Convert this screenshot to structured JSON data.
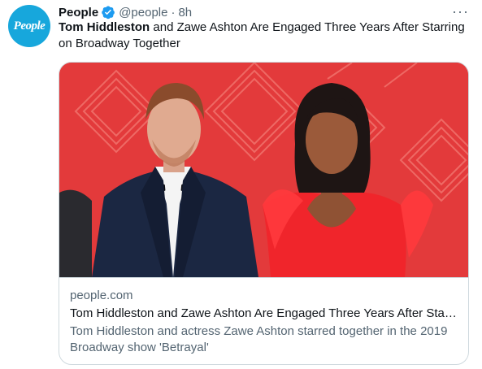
{
  "account": {
    "avatar_text": "People",
    "display_name": "People",
    "handle": "@people",
    "separator": "·",
    "time": "8h"
  },
  "more_label": "···",
  "tweet": {
    "title_bold": "Tom Hiddleston",
    "title_rest": " and Zawe Ashton Are Engaged Three Years After Starring on Broadway Together"
  },
  "card": {
    "domain": "people.com",
    "title": "Tom Hiddleston and Zawe Ashton Are Engaged Three Years After Starring on Broadway Together",
    "description": "Tom Hiddleston and actress Zawe Ashton starred together in the 2019 Broadway show 'Betrayal'"
  },
  "colors": {
    "brand": "#17a7dc",
    "verified": "#1d9bf0",
    "secondary_text": "#536471",
    "border": "#cfd9de",
    "photo_background": "#e63b3a"
  },
  "icons": [
    "people-logo",
    "verified-badge-icon",
    "more-icon"
  ]
}
